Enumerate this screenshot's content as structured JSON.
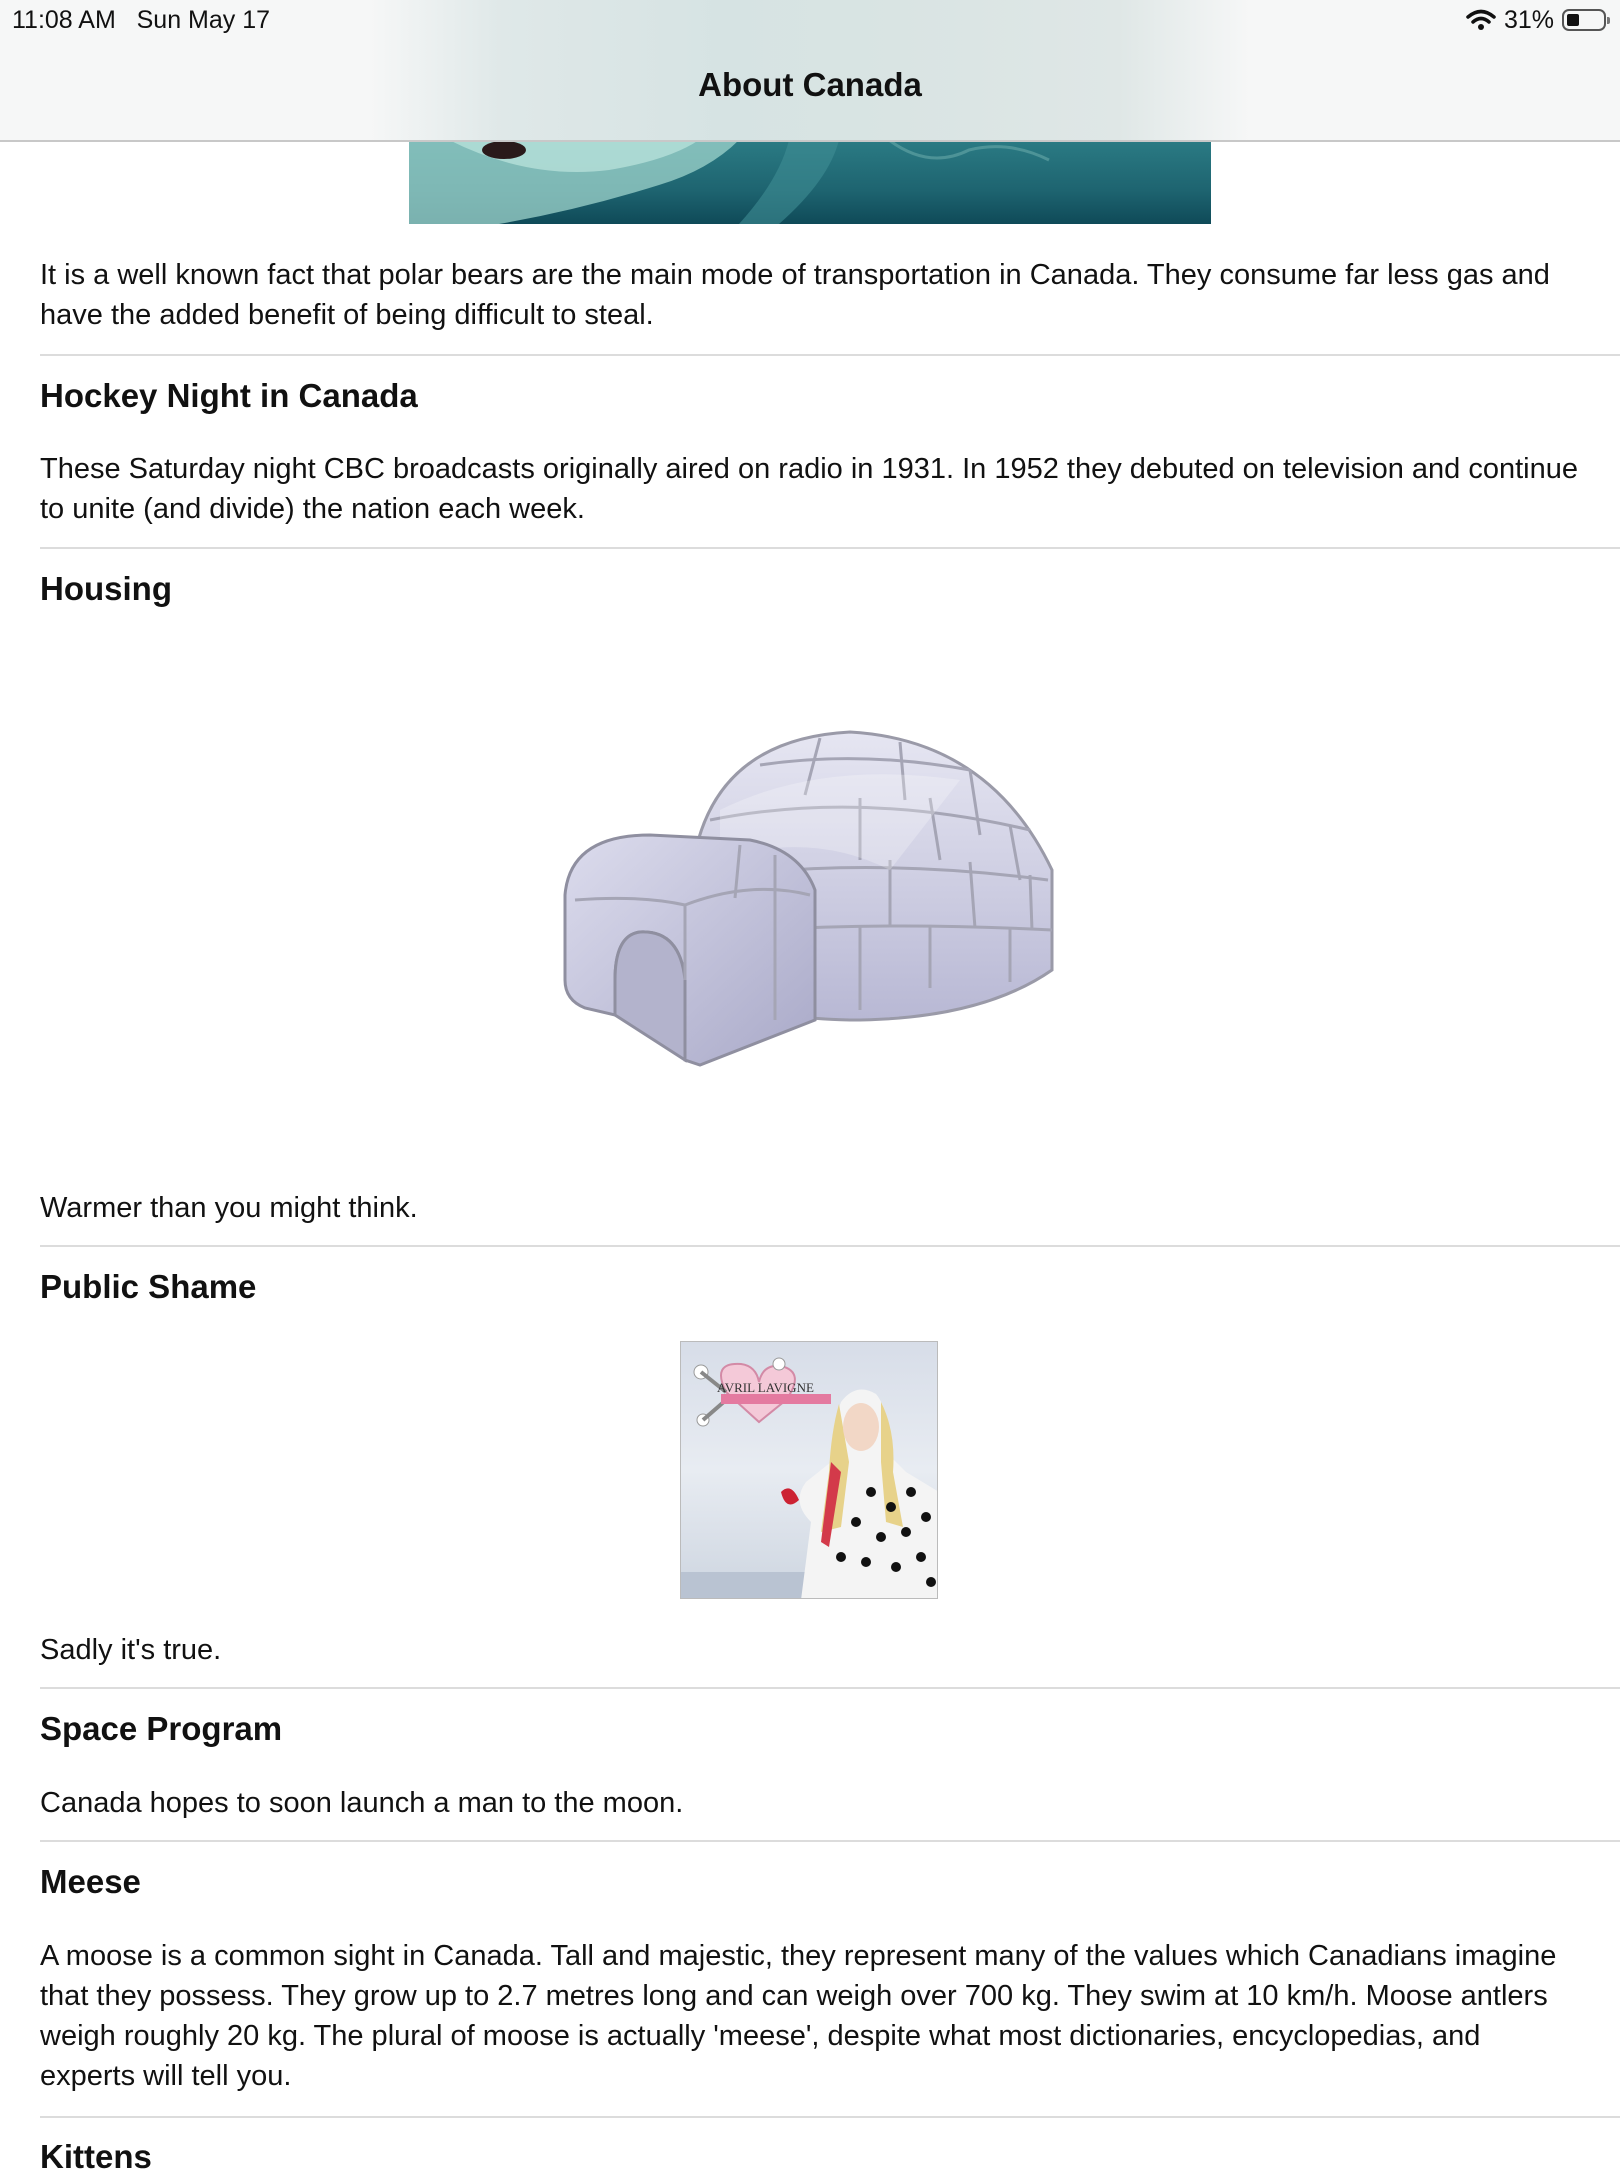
{
  "status_bar": {
    "time": "11:08 AM",
    "date": "Sun May 17",
    "battery": "31%"
  },
  "nav": {
    "title": "About Canada"
  },
  "sections": {
    "polar": {
      "text": "It is a well known fact that polar bears are the main mode of transportation in Canada. They consume far less gas and have the added benefit of being difficult to steal."
    },
    "hockey": {
      "title": "Hockey Night in Canada",
      "text": "These Saturday night CBC broadcasts originally aired on radio in 1931. In 1952 they debuted on television and continue to unite (and divide) the nation each week."
    },
    "housing": {
      "title": "Housing",
      "text": "Warmer than you might think."
    },
    "shame": {
      "title": "Public Shame",
      "text": " Sadly it's true.",
      "album_artist": "AVRIL LAVIGNE"
    },
    "space": {
      "title": "Space Program",
      "text": "Canada hopes to soon launch a man to the moon."
    },
    "meese": {
      "title": "Meese",
      "text": "A moose is a common sight in Canada. Tall and majestic, they represent many of the values which Canadians imagine that they possess. They grow up to 2.7 metres long and can weigh over 700 kg. They swim at 10 km/h. Moose antlers weigh roughly 20 kg. The plural of moose is actually 'meese', despite what most dictionaries, encyclopedias, and experts will tell you."
    },
    "kittens": {
      "title": "Kittens"
    }
  },
  "icons": {
    "wifi": "wifi-icon",
    "battery": "battery-icon"
  }
}
